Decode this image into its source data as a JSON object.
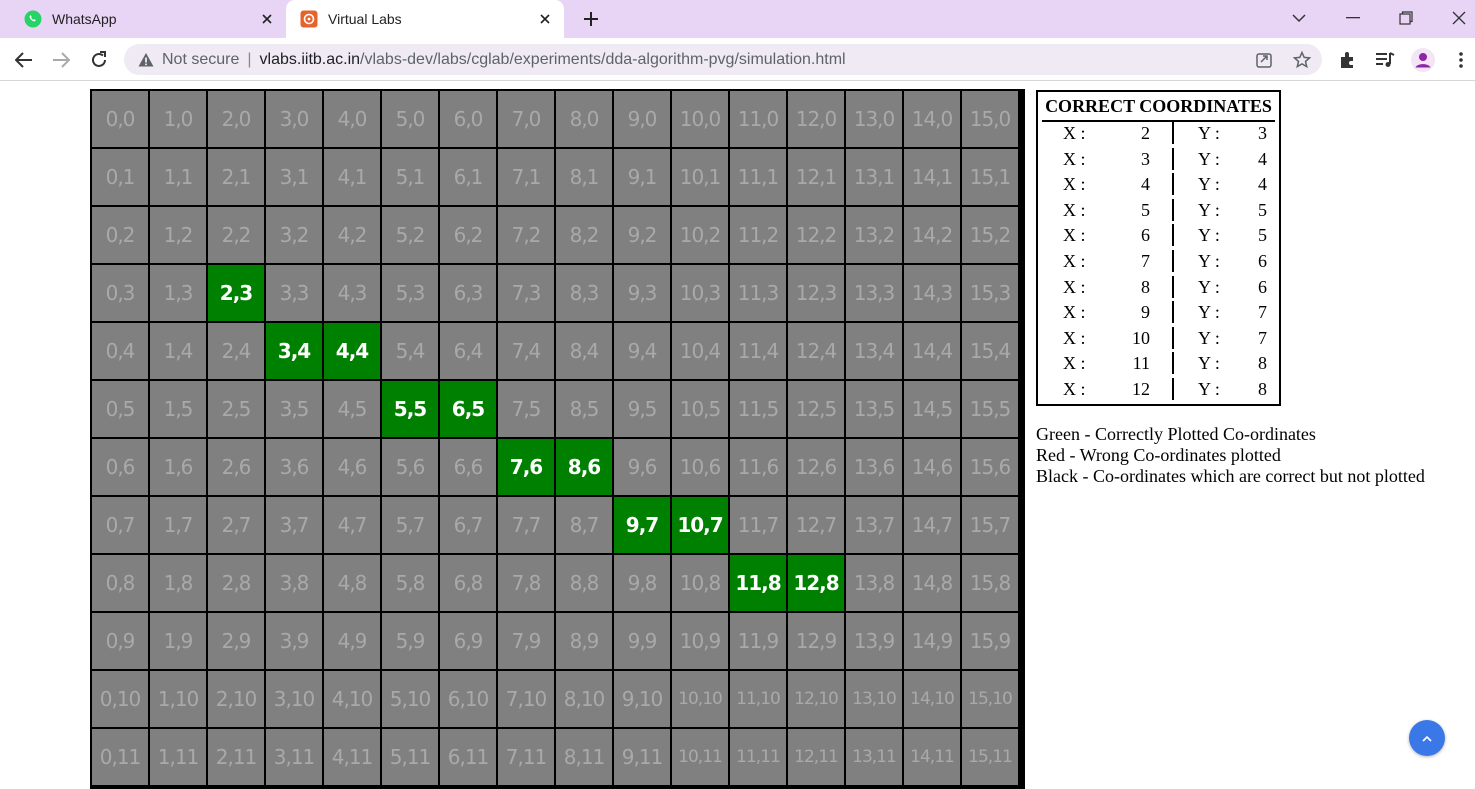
{
  "browser": {
    "tabs": [
      {
        "title": "WhatsApp",
        "icon": "whatsapp-icon",
        "active": false
      },
      {
        "title": "Virtual Labs",
        "icon": "virtual-labs-icon",
        "active": true
      }
    ],
    "security_label": "Not secure",
    "separator": "|",
    "url_host": "vlabs.iitb.ac.in",
    "url_path": "/vlabs-dev/labs/cglab/experiments/dda-algorithm-pvg/simulation.html",
    "colors": {
      "titlebar": "#e8d5f6",
      "omnibox": "#efeaf3",
      "profile": "#8e24aa"
    }
  },
  "grid": {
    "columns": 16,
    "rows_visible": 12,
    "cell_color": "#808080",
    "label_color": "#a9a9a9",
    "correct_color": "#008000",
    "plotted": [
      [
        2,
        3
      ],
      [
        3,
        4
      ],
      [
        4,
        4
      ],
      [
        5,
        5
      ],
      [
        6,
        5
      ],
      [
        7,
        6
      ],
      [
        8,
        6
      ],
      [
        9,
        7
      ],
      [
        10,
        7
      ],
      [
        11,
        8
      ],
      [
        12,
        8
      ]
    ]
  },
  "coordinates": {
    "title": "CORRECT COORDINATES",
    "x_label": "X :",
    "y_label": "Y :",
    "rows": [
      {
        "x": "2",
        "y": "3"
      },
      {
        "x": "3",
        "y": "4"
      },
      {
        "x": "4",
        "y": "4"
      },
      {
        "x": "5",
        "y": "5"
      },
      {
        "x": "6",
        "y": "5"
      },
      {
        "x": "7",
        "y": "6"
      },
      {
        "x": "8",
        "y": "6"
      },
      {
        "x": "9",
        "y": "7"
      },
      {
        "x": "10",
        "y": "7"
      },
      {
        "x": "11",
        "y": "8"
      },
      {
        "x": "12",
        "y": "8"
      }
    ]
  },
  "legend": {
    "green": "Green - Correctly Plotted Co-ordinates",
    "red": "Red - Wrong Co-ordinates plotted",
    "black": "Black - Co-ordinates which are correct but not plotted"
  }
}
